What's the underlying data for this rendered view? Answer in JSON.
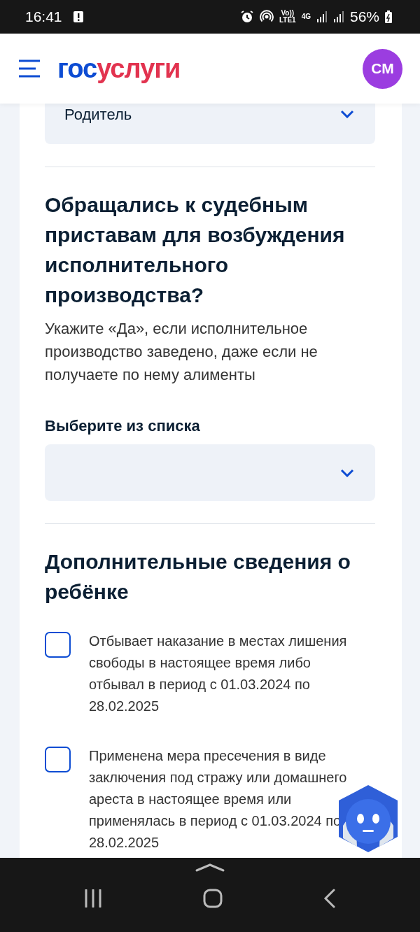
{
  "status_bar": {
    "time": "16:41",
    "volte": "Vo))",
    "lte": "LTE1",
    "network": "4G",
    "battery": "56%"
  },
  "header": {
    "logo": [
      "гос",
      "услуги"
    ],
    "avatar": "СМ"
  },
  "previous_select": {
    "value": "Родитель"
  },
  "question": {
    "title": "Обращались к судебным приставам для возбуждения исполнительного производства?",
    "hint": "Укажите «Да», если исполнительное производство заведено, даже если не получаете по нему алименты",
    "label": "Выберите из списка"
  },
  "section": {
    "title": "Дополнительные сведения о ребёнке",
    "options": [
      {
        "text": "Отбывает наказание в местах лишения свободы в настоящее время либо отбывал в период с 01.03.2024 по 28.02.2025",
        "checked": false
      },
      {
        "text": "Применена мера пресечения в виде заключения под стражу или домашнего ареста в настоящее время или применялась в период с 01.03.2024 по 28.02.2025",
        "checked": false
      }
    ]
  }
}
